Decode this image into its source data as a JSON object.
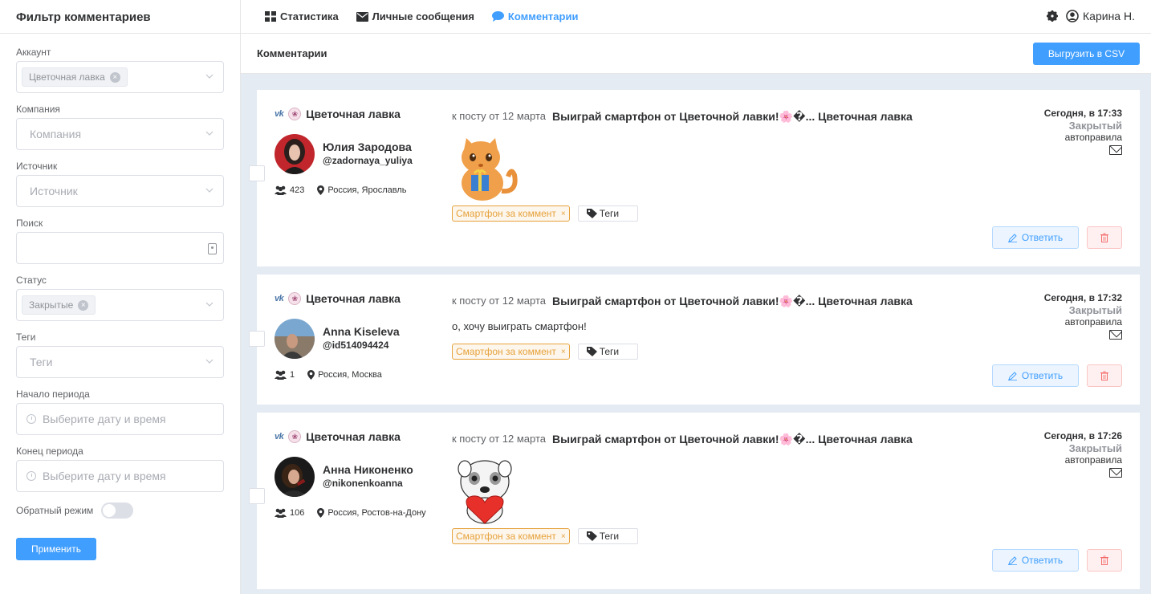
{
  "sidebar": {
    "title": "Фильтр комментариев",
    "fields": {
      "account_label": "Аккаунт",
      "account_chip": "Цветочная лавка",
      "company_label": "Компания",
      "company_placeholder": "Компания",
      "source_label": "Источник",
      "source_placeholder": "Источник",
      "search_label": "Поиск",
      "status_label": "Статус",
      "status_chip": "Закрытые",
      "tags_label": "Теги",
      "tags_placeholder": "Теги",
      "start_label": "Начало периода",
      "start_placeholder": "Выберите дату и время",
      "end_label": "Конец периода",
      "end_placeholder": "Выберите дату и время",
      "reverse_label": "Обратный режим"
    },
    "apply_label": "Применить"
  },
  "topnav": {
    "items": [
      "Статистика",
      "Личные сообщения",
      "Комментарии"
    ],
    "active": "Комментарии",
    "user": "Карина Н."
  },
  "main": {
    "title": "Комментарии",
    "csv_label": "Выгрузить в CSV"
  },
  "comments": [
    {
      "account": "Цветочная лавка",
      "vk": "vk",
      "name": "Юлия Зародова",
      "handle": "@zadornaya_yuliya",
      "friends": "423",
      "location": "Россия, Ярославль",
      "post_prefix": "к посту от 12 марта",
      "post_title": "Выиграй смартфон от Цветочной лавки!🌸�... Цветочная лавка",
      "text": "",
      "tag": "Смартфон за коммент",
      "tags_btn": "Теги",
      "date": "Сегодня, в 17:33",
      "status": "Закрытый",
      "rule": "автоправила",
      "reply": "Ответить"
    },
    {
      "account": "Цветочная лавка",
      "vk": "vk",
      "name": "Anna Kiseleva",
      "handle": "@id514094424",
      "friends": "1",
      "location": "Россия, Москва",
      "post_prefix": "к посту от 12 марта",
      "post_title": "Выиграй смартфон от Цветочной лавки!🌸�... Цветочная лавка",
      "text": "о, хочу выиграть смартфон!",
      "tag": "Смартфон за коммент",
      "tags_btn": "Теги",
      "date": "Сегодня, в 17:32",
      "status": "Закрытый",
      "rule": "автоправила",
      "reply": "Ответить"
    },
    {
      "account": "Цветочная лавка",
      "vk": "vk",
      "name": "Анна Никоненко",
      "handle": "@nikonenkoanna",
      "friends": "106",
      "location": "Россия, Ростов-на-Дону",
      "post_prefix": "к посту от 12 марта",
      "post_title": "Выиграй смартфон от Цветочной лавки!🌸�... Цветочная лавка",
      "text": "",
      "tag": "Смартфон за коммент",
      "tags_btn": "Теги",
      "date": "Сегодня, в 17:26",
      "status": "Закрытый",
      "rule": "автоправила",
      "reply": "Ответить"
    }
  ]
}
